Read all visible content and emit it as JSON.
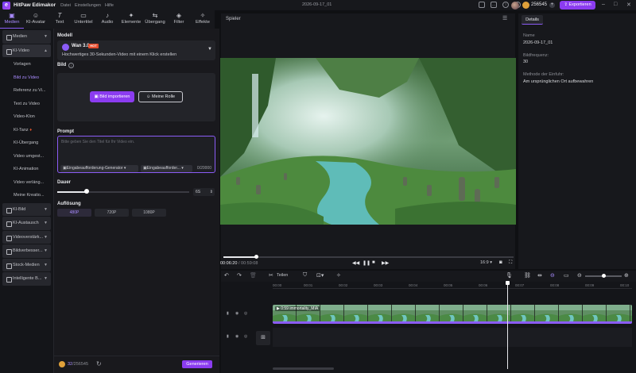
{
  "app": {
    "name": "HitPaw Edimakor",
    "menu": [
      "Datei",
      "Einstellungen",
      "Hilfe"
    ],
    "project_name": "2026-09-17_01",
    "credits": "256545",
    "export_label": "Exportieren",
    "accent": "#8b3cf0"
  },
  "toolbar": [
    {
      "label": "Medien",
      "icon": "media-icon"
    },
    {
      "label": "KI-Avatar",
      "icon": "avatar-icon"
    },
    {
      "label": "Text",
      "icon": "text-icon"
    },
    {
      "label": "Untertitel",
      "icon": "subtitle-icon"
    },
    {
      "label": "Audio",
      "icon": "audio-icon"
    },
    {
      "label": "Elemente",
      "icon": "elements-icon"
    },
    {
      "label": "Übergang",
      "icon": "transition-icon"
    },
    {
      "label": "Filter",
      "icon": "filter-icon"
    },
    {
      "label": "Effekte",
      "icon": "effects-icon"
    }
  ],
  "sidebar": {
    "medien": "Medien",
    "ki_video": "KI-Video",
    "sub_items": [
      "Vorlagen",
      "Bild zu Video",
      "Referenz zu Vi...",
      "Text zu Video",
      "Video-Klon",
      "KI-Tanz",
      "KI-Übergang",
      "Video umgest...",
      "KI-Animation",
      "Video verläng...",
      "Meine Kreatio..."
    ],
    "groups": [
      "KI-Bild",
      "KI-Austausch",
      "Videoverstärk...",
      "Bildverbesser...",
      "Stock-Medien",
      "Intelligente B..."
    ]
  },
  "panel": {
    "model_label": "Modell",
    "model_name": "Wan 3.0",
    "model_badge": "HOT",
    "model_desc": "Hochwertiges 30-Sekunden-Video mit einem Klick erstellen",
    "bild_label": "Bild",
    "import_btn": "Bild importieren",
    "role_btn": "Meine Rolle",
    "prompt_label": "Prompt",
    "prompt_placeholder": "Bitte geben Sie den Titel für Ihr Video ein.",
    "chip1": "Eingabeaufforderung-Generator",
    "chip2": "Eingabeaufforder...",
    "counter": "0/20000",
    "duration_label": "Dauer",
    "duration_value": "6S",
    "resolution_label": "Auflösung",
    "resolutions": [
      "480P",
      "720P",
      "1080P"
    ],
    "footer_credits": "32",
    "footer_credits_total": "256545",
    "generate_btn": "Generieren"
  },
  "player": {
    "label": "Spieler",
    "time_current": "00:06:20",
    "time_total": "00:59:08",
    "ratio": "16:9"
  },
  "details": {
    "tab": "Details",
    "name_label": "Name",
    "name_value": "2026-09-17_01",
    "fps_label": "Bildfrequenz:",
    "fps_value": "30",
    "method_label": "Methode der Einfuhr:",
    "method_value": "Am ursprünglichen Ort aufbewahren"
  },
  "timeline": {
    "share_label": "Teilen",
    "ruler": [
      "00:00",
      "00:01",
      "00:02",
      "00:03",
      "00:04",
      "00:05",
      "00:06",
      "00:07",
      "00:08",
      "00:09",
      "00:10"
    ],
    "clip_label": "0:59 immortality_MIA"
  }
}
